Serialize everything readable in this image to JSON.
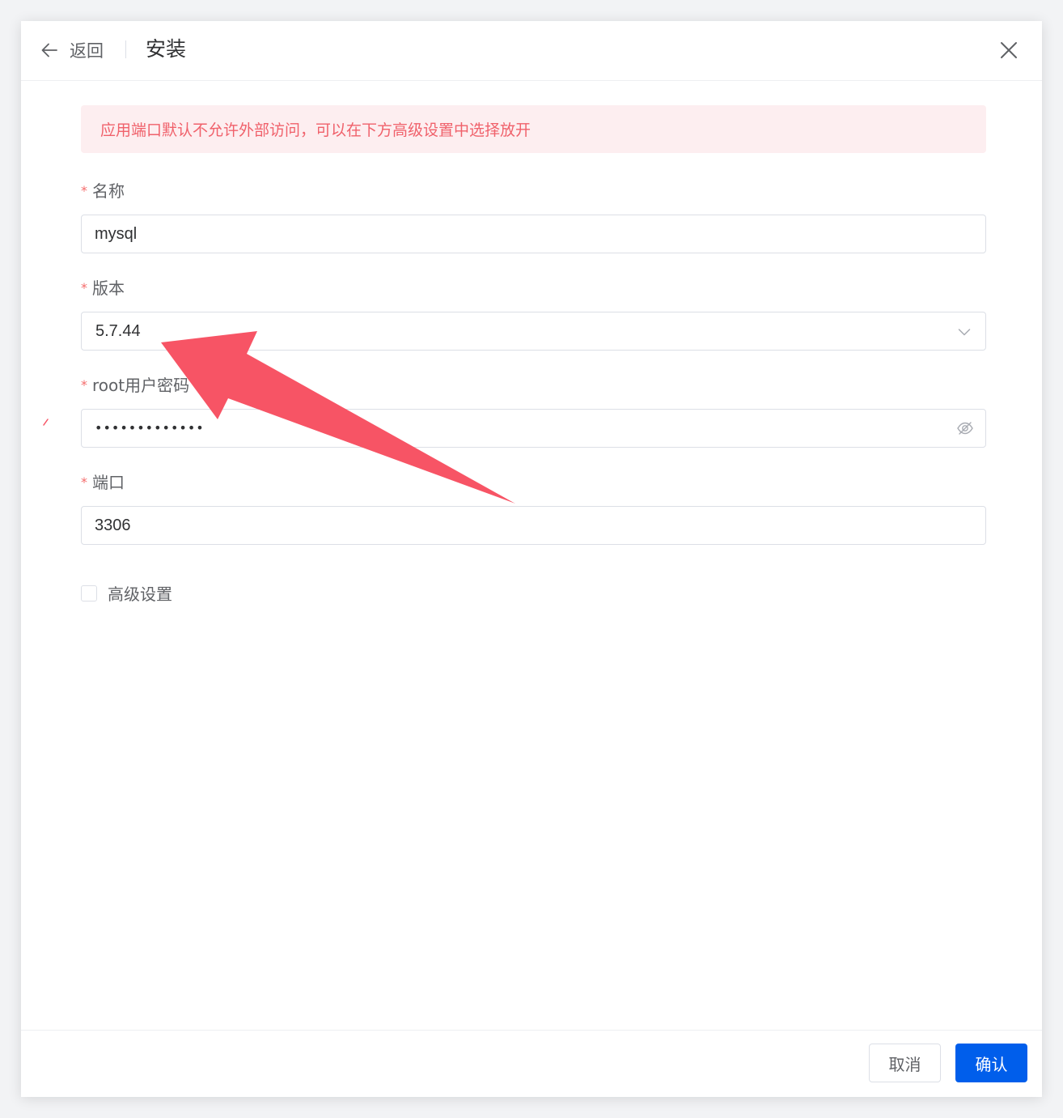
{
  "header": {
    "back_label": "返回",
    "title": "安装"
  },
  "alert": {
    "text": "应用端口默认不允许外部访问，可以在下方高级设置中选择放开"
  },
  "form": {
    "required_mark": "*",
    "name": {
      "label": "名称",
      "value": "mysql"
    },
    "version": {
      "label": "版本",
      "value": "5.7.44"
    },
    "root_password": {
      "label": "root用户密码",
      "masked_value": "•••••••••••••"
    },
    "port": {
      "label": "端口",
      "value": "3306"
    },
    "advanced": {
      "label": "高级设置",
      "checked": false
    }
  },
  "footer": {
    "cancel_label": "取消",
    "confirm_label": "确认"
  },
  "colors": {
    "primary": "#005eeb",
    "alert_text": "#f0616b",
    "alert_bg": "#fdeef0",
    "annotation_arrow": "#f75465"
  },
  "icons": {
    "back": "arrow-left-icon",
    "close": "close-icon",
    "select": "chevron-down-icon",
    "password": "eye-off-icon"
  }
}
